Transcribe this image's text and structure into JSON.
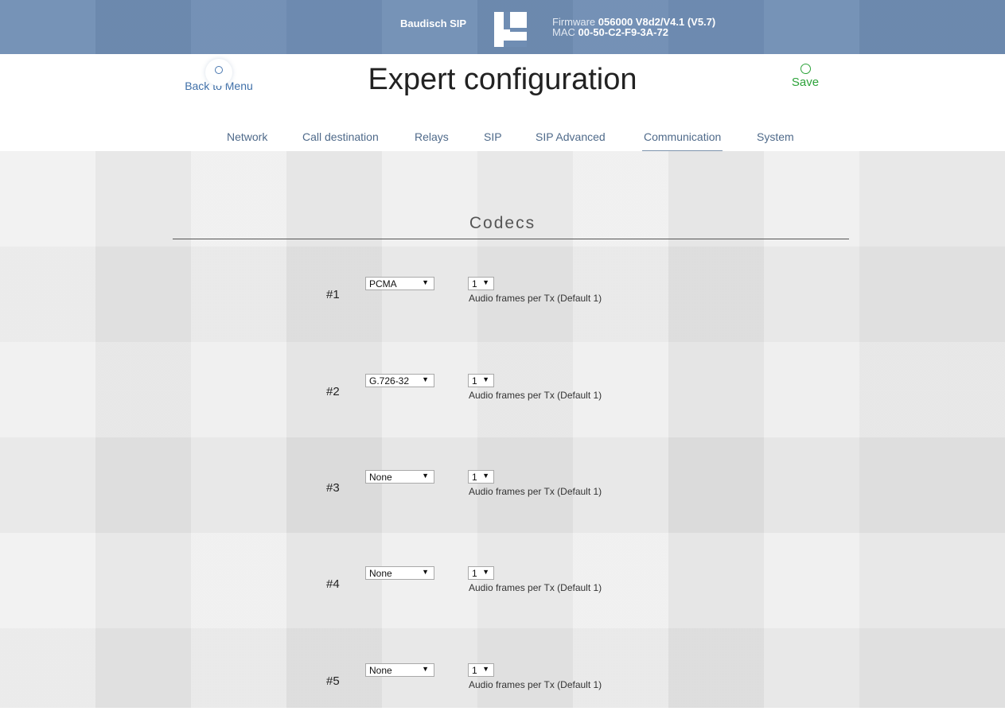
{
  "header": {
    "device_name": "Baudisch SIP",
    "firmware_label": "Firmware",
    "firmware_value": "056000 V8d2/V4.1 (V5.7)",
    "mac_label": "MAC",
    "mac_value": "00-50-C2-F9-3A-72"
  },
  "nav": {
    "back_label": "Back to Menu",
    "title": "Expert configuration",
    "save_label": "Save"
  },
  "tabs": [
    {
      "label": "Network"
    },
    {
      "label": "Call destination"
    },
    {
      "label": "Relays"
    },
    {
      "label": "SIP"
    },
    {
      "label": "SIP Advanced"
    },
    {
      "label": "Communication",
      "active": true
    },
    {
      "label": "System"
    }
  ],
  "section": {
    "title": "Codecs",
    "rows": [
      {
        "index": "#1",
        "codec": "PCMA",
        "frames": "1",
        "hint": "Audio frames per Tx (Default 1)"
      },
      {
        "index": "#2",
        "codec": "G.726-32",
        "frames": "1",
        "hint": "Audio frames per Tx (Default 1)"
      },
      {
        "index": "#3",
        "codec": "None",
        "frames": "1",
        "hint": "Audio frames per Tx (Default 1)"
      },
      {
        "index": "#4",
        "codec": "None",
        "frames": "1",
        "hint": "Audio frames per Tx (Default 1)"
      },
      {
        "index": "#5",
        "codec": "None",
        "frames": "1",
        "hint": "Audio frames per Tx (Default 1)"
      }
    ]
  },
  "colors": {
    "topbar": "#6f8db3",
    "save": "#2da33a",
    "link": "#3f6fa8"
  }
}
